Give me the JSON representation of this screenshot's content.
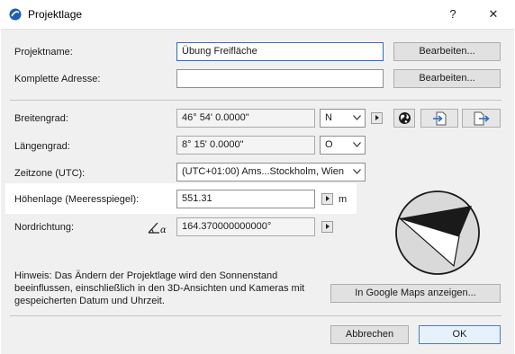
{
  "window": {
    "title": "Projektlage",
    "help_label": "?",
    "close_label": "✕"
  },
  "fields": {
    "projektname": {
      "label": "Projektname:",
      "value": "Übung Freifläche",
      "button": "Bearbeiten..."
    },
    "adresse": {
      "label": "Komplette Adresse:",
      "value": "",
      "button": "Bearbeiten..."
    },
    "breitengrad": {
      "label": "Breitengrad:",
      "value": "46° 54' 0.0000\"",
      "direction": "N"
    },
    "laengengrad": {
      "label": "Längengrad:",
      "value": "8° 15' 0.0000\"",
      "direction": "O"
    },
    "zeitzone": {
      "label": "Zeitzone (UTC):",
      "value": "(UTC+01:00) Ams...Stockholm, Wien"
    },
    "hoehenlage": {
      "label": "Höhenlage (Meeresspiegel):",
      "value": "551.31",
      "unit": "m"
    },
    "nordrichtung": {
      "label": "Nordrichtung:",
      "value": "164.370000000000°"
    }
  },
  "hint": {
    "text_line1": "Hinweis: Das Ändern der Projektlage wird den Sonnenstand",
    "text_line2": "beeinflussen, einschließlich in den 3D-Ansichten und Kameras mit",
    "text_line3": "gespeicherten Datum und Uhrzeit."
  },
  "buttons": {
    "google_maps": "In Google Maps anzeigen...",
    "cancel": "Abbrechen",
    "ok": "OK"
  },
  "icons": {
    "app": "archicad-icon",
    "globe": "globe-icon",
    "import": "import-location-icon",
    "export": "export-location-icon",
    "north_angle": "angle-icon"
  },
  "compass": {
    "north_angle_deg": 164.37
  },
  "colors": {
    "accent": "#2b6dc7",
    "focus_border": "#4d7ac0"
  }
}
